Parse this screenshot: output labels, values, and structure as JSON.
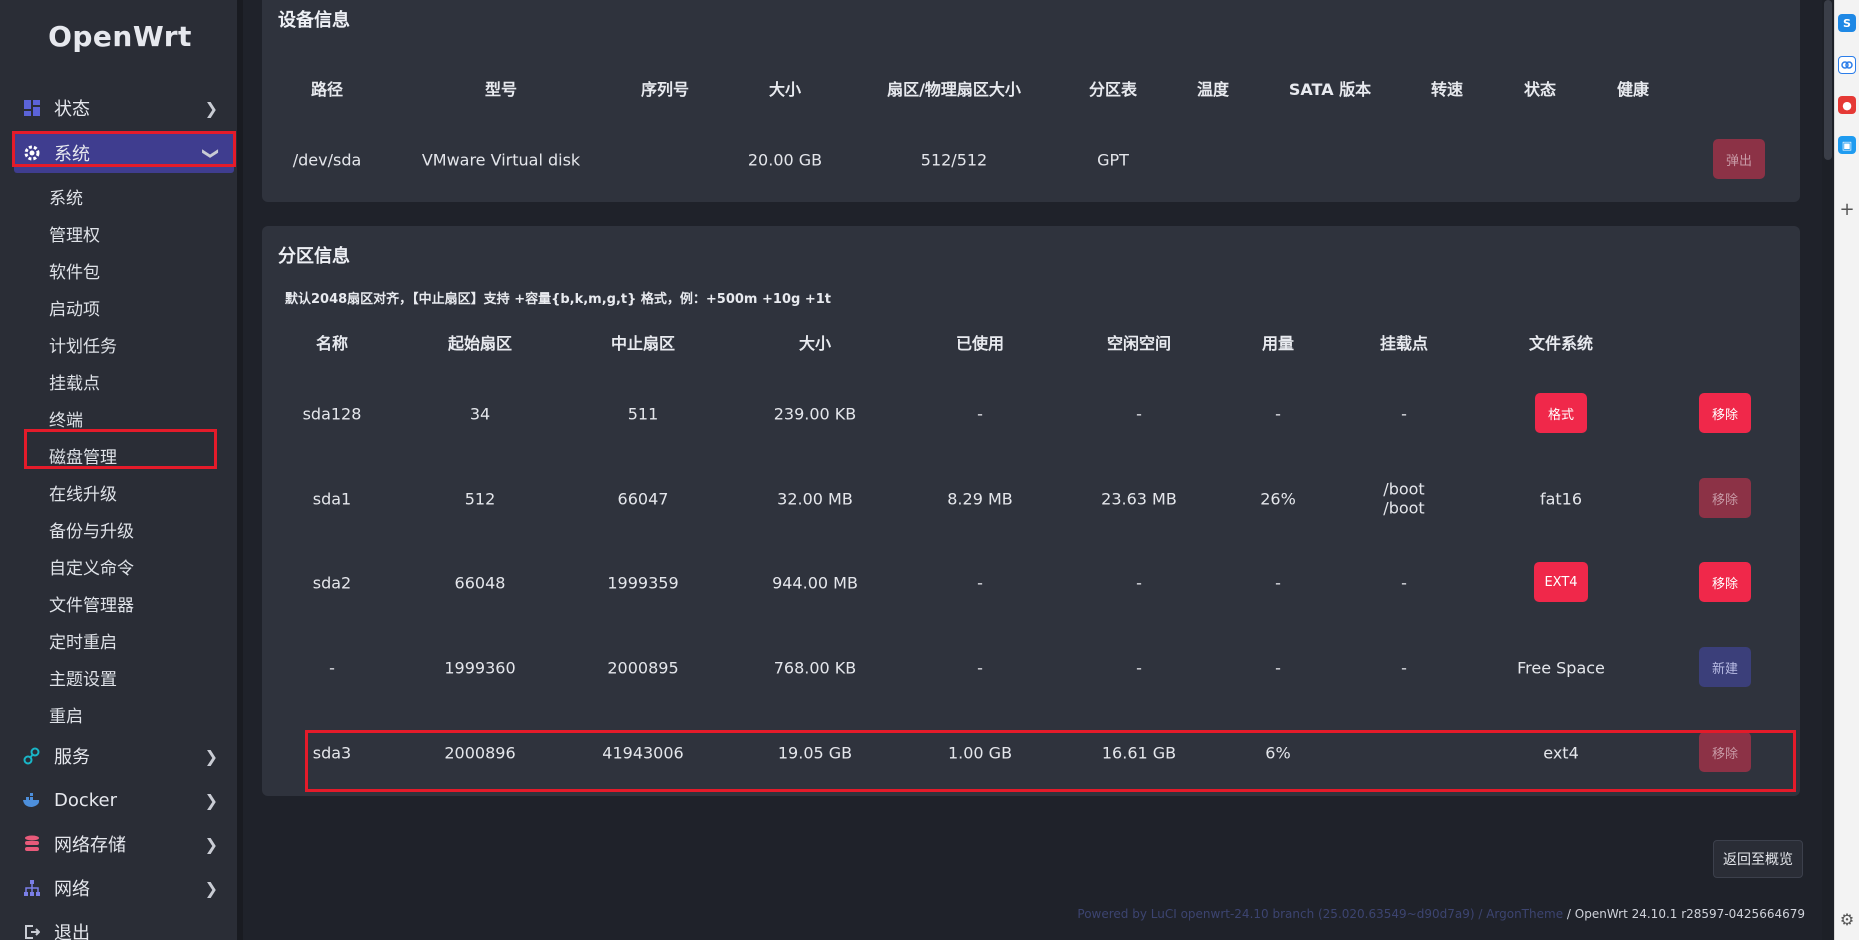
{
  "app": {
    "logo": "OpenWrt"
  },
  "sidebar": {
    "status": "状态",
    "system": "系统",
    "sub": [
      "系统",
      "管理权",
      "软件包",
      "启动项",
      "计划任务",
      "挂载点",
      "终端",
      "磁盘管理",
      "在线升级",
      "备份与升级",
      "自定义命令",
      "文件管理器",
      "定时重启",
      "主题设置",
      "重启"
    ],
    "services": "服务",
    "docker": "Docker",
    "nas": "网络存储",
    "network": "网络",
    "logout": "退出"
  },
  "device": {
    "title": "设备信息",
    "headers": [
      "路径",
      "型号",
      "序列号",
      "大小",
      "扇区/物理扇区大小",
      "分区表",
      "温度",
      "SATA 版本",
      "转速",
      "状态",
      "健康"
    ],
    "row": {
      "path": "/dev/sda",
      "model": "VMware Virtual disk",
      "serial": "",
      "size": "20.00 GB",
      "sector": "512/512",
      "table": "GPT",
      "temp": "",
      "sata": "",
      "rpm": "",
      "status": "",
      "health": ""
    },
    "eject": "弹出"
  },
  "partitions": {
    "title": "分区信息",
    "note": "默认2048扇区对齐，【中止扇区】支持 +容量{b,k,m,g,t} 格式，例：+500m +10g +1t",
    "headers": [
      "名称",
      "起始扇区",
      "中止扇区",
      "大小",
      "已使用",
      "空闲空间",
      "用量",
      "挂载点",
      "文件系统"
    ],
    "rows": [
      {
        "name": "sda128",
        "start": "34",
        "end": "511",
        "size": "239.00 KB",
        "used": "-",
        "free": "-",
        "usage": "-",
        "mount": "-",
        "mount2": "",
        "fs": "格式",
        "fs_is_button": true,
        "action": "移除"
      },
      {
        "name": "sda1",
        "start": "512",
        "end": "66047",
        "size": "32.00 MB",
        "used": "8.29 MB",
        "free": "23.63 MB",
        "usage": "26%",
        "mount": "/boot",
        "mount2": "/boot",
        "fs": "fat16",
        "fs_is_button": false,
        "action": "移除"
      },
      {
        "name": "sda2",
        "start": "66048",
        "end": "1999359",
        "size": "944.00 MB",
        "used": "-",
        "free": "-",
        "usage": "-",
        "mount": "-",
        "mount2": "",
        "fs": "EXT4",
        "fs_is_button": true,
        "action": "移除"
      },
      {
        "name": "-",
        "start": "1999360",
        "end": "2000895",
        "size": "768.00 KB",
        "used": "-",
        "free": "-",
        "usage": "-",
        "mount": "-",
        "mount2": "",
        "fs": "Free Space",
        "fs_is_button": false,
        "action": "新建"
      },
      {
        "name": "sda3",
        "start": "2000896",
        "end": "41943006",
        "size": "19.05 GB",
        "used": "1.00 GB",
        "free": "16.61 GB",
        "usage": "6%",
        "mount": "",
        "mount2": "",
        "fs": "ext4",
        "fs_is_button": false,
        "action": "移除"
      }
    ]
  },
  "back_button": "返回至概览",
  "footer": {
    "faint": "Powered by LuCI openwrt-24.10 branch (25.020.63549~d90d7a9) / ArgonTheme",
    "version": "/ OpenWrt 24.10.1 r28597-0425664679"
  },
  "colors": {
    "accent": "#3f3d8f",
    "danger": "#f0284a",
    "highlight": "#e41b2a"
  }
}
